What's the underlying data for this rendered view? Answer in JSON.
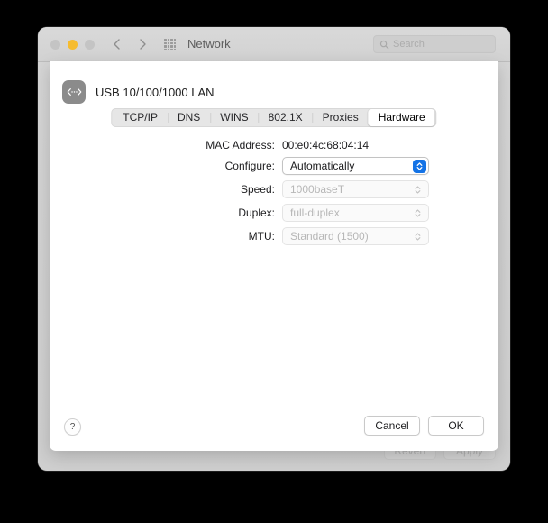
{
  "window": {
    "title": "Network",
    "traffic_lights": [
      "close",
      "minimize",
      "zoom"
    ],
    "nav_back_icon": "chevron-left-icon",
    "nav_forward_icon": "chevron-right-icon",
    "grid_icon": "show-all-grid-icon",
    "search": {
      "placeholder": "Search",
      "icon": "search-icon"
    },
    "background_buttons": {
      "revert": "Revert",
      "apply": "Apply"
    }
  },
  "sheet": {
    "interface": {
      "icon": "ethernet-icon",
      "name": "USB 10/100/1000 LAN"
    },
    "tabs": [
      {
        "label": "TCP/IP",
        "selected": false
      },
      {
        "label": "DNS",
        "selected": false
      },
      {
        "label": "WINS",
        "selected": false
      },
      {
        "label": "802.1X",
        "selected": false
      },
      {
        "label": "Proxies",
        "selected": false
      },
      {
        "label": "Hardware",
        "selected": true
      }
    ],
    "fields": {
      "mac_address": {
        "label": "MAC Address:",
        "value": "00:e0:4c:68:04:14"
      },
      "configure": {
        "label": "Configure:",
        "value": "Automatically",
        "enabled": true
      },
      "speed": {
        "label": "Speed:",
        "value": "1000baseT",
        "enabled": false
      },
      "duplex": {
        "label": "Duplex:",
        "value": "full-duplex",
        "enabled": false
      },
      "mtu": {
        "label": "MTU:",
        "value": "Standard (1500)",
        "enabled": false
      }
    },
    "footer": {
      "help": "?",
      "cancel": "Cancel",
      "ok": "OK"
    }
  },
  "colors": {
    "accent_blue": "#1473e6",
    "amber_light": "#f6bc2f",
    "window_gray": "#d4d4d4",
    "sheet_white": "#ffffff",
    "disabled_text": "#b7b7b7"
  }
}
